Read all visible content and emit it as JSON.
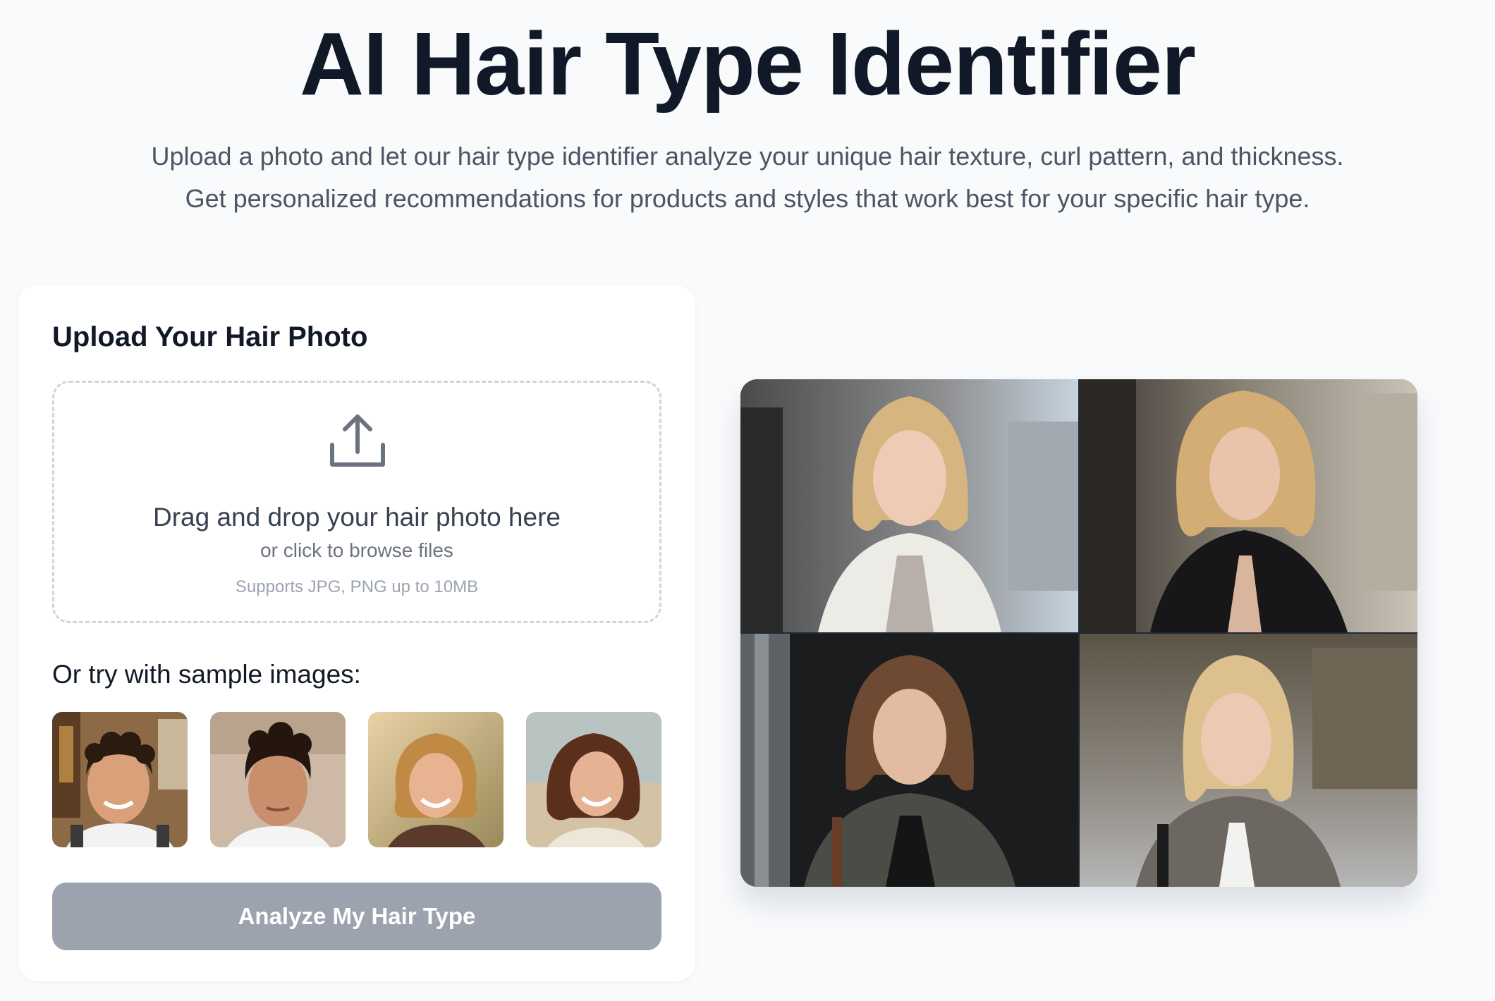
{
  "hero": {
    "title": "AI Hair Type Identifier",
    "description_line1": "Upload a photo and let our hair type identifier analyze your unique hair texture, curl pattern, and thickness.",
    "description_line2": "Get personalized recommendations for products and styles that work best for your specific hair type."
  },
  "upload": {
    "title": "Upload Your Hair Photo",
    "icon": "upload-icon",
    "drop_text": "Drag and drop your hair photo here",
    "browse_text": "or click to browse files",
    "supports_text": "Supports JPG, PNG up to 10MB"
  },
  "samples": {
    "title": "Or try with sample images:",
    "items": [
      {
        "subject": "smiling man with curly dark hair"
      },
      {
        "subject": "man with wavy dark hair"
      },
      {
        "subject": "smiling woman with curly blonde bob"
      },
      {
        "subject": "smiling woman with wavy brown bob"
      }
    ]
  },
  "analyze_button": {
    "label": "Analyze My Hair Type"
  },
  "showcase": {
    "tiles": [
      {
        "subject": "blonde woman in white jacket on city street"
      },
      {
        "subject": "blonde woman in black jacket on city street"
      },
      {
        "subject": "brown-haired woman in dark jacket"
      },
      {
        "subject": "blonde woman in tweed jacket on street"
      }
    ]
  },
  "colors": {
    "page_background": "#f8fafc",
    "title": "#111827",
    "body_text": "#4b5563",
    "button_disabled": "#9ca3af",
    "dropzone_border": "#d1d5db"
  }
}
